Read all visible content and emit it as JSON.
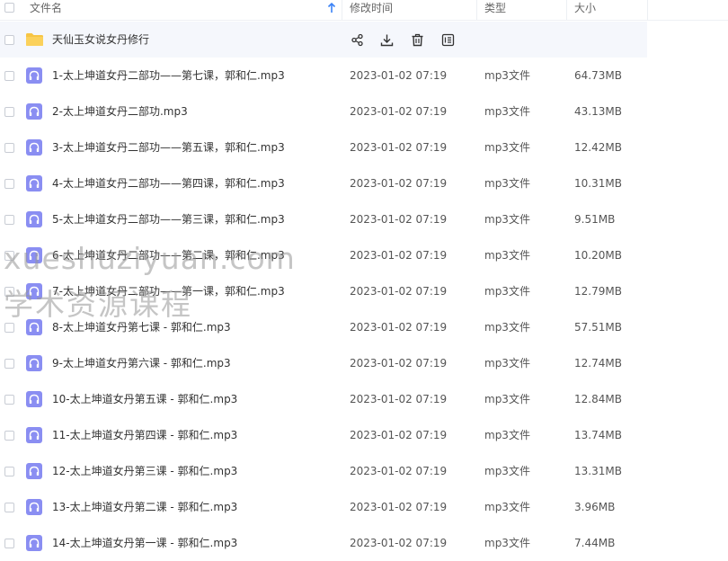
{
  "header": {
    "name_label": "文件名",
    "time_label": "修改时间",
    "type_label": "类型",
    "size_label": "大小"
  },
  "folder": {
    "name": "天仙玉女说女丹修行",
    "actions": [
      "share-icon",
      "download-icon",
      "delete-icon",
      "more-icon"
    ]
  },
  "files": [
    {
      "name": "1-太上坤道女丹二部功——第七课，郭和仁.mp3",
      "time": "2023-01-02 07:19",
      "type": "mp3文件",
      "size": "64.73MB"
    },
    {
      "name": "2-太上坤道女丹二部功.mp3",
      "time": "2023-01-02 07:19",
      "type": "mp3文件",
      "size": "43.13MB"
    },
    {
      "name": "3-太上坤道女丹二部功——第五课，郭和仁.mp3",
      "time": "2023-01-02 07:19",
      "type": "mp3文件",
      "size": "12.42MB"
    },
    {
      "name": "4-太上坤道女丹二部功——第四课，郭和仁.mp3",
      "time": "2023-01-02 07:19",
      "type": "mp3文件",
      "size": "10.31MB"
    },
    {
      "name": "5-太上坤道女丹二部功——第三课，郭和仁.mp3",
      "time": "2023-01-02 07:19",
      "type": "mp3文件",
      "size": "9.51MB"
    },
    {
      "name": "6-太上坤道女丹二部功——第二课，郭和仁.mp3",
      "time": "2023-01-02 07:19",
      "type": "mp3文件",
      "size": "10.20MB"
    },
    {
      "name": "7-太上坤道女丹二部功——第一课，郭和仁.mp3",
      "time": "2023-01-02 07:19",
      "type": "mp3文件",
      "size": "12.79MB"
    },
    {
      "name": "8-太上坤道女丹第七课 - 郭和仁.mp3",
      "time": "2023-01-02 07:19",
      "type": "mp3文件",
      "size": "57.51MB"
    },
    {
      "name": "9-太上坤道女丹第六课 - 郭和仁.mp3",
      "time": "2023-01-02 07:19",
      "type": "mp3文件",
      "size": "12.74MB"
    },
    {
      "name": "10-太上坤道女丹第五课 - 郭和仁.mp3",
      "time": "2023-01-02 07:19",
      "type": "mp3文件",
      "size": "12.84MB"
    },
    {
      "name": "11-太上坤道女丹第四课 - 郭和仁.mp3",
      "time": "2023-01-02 07:19",
      "type": "mp3文件",
      "size": "13.74MB"
    },
    {
      "name": "12-太上坤道女丹第三课 - 郭和仁.mp3",
      "time": "2023-01-02 07:19",
      "type": "mp3文件",
      "size": "13.31MB"
    },
    {
      "name": "13-太上坤道女丹第二课 - 郭和仁.mp3",
      "time": "2023-01-02 07:19",
      "type": "mp3文件",
      "size": "3.96MB"
    },
    {
      "name": "14-太上坤道女丹第一课 - 郭和仁.mp3",
      "time": "2023-01-02 07:19",
      "type": "mp3文件",
      "size": "7.44MB"
    }
  ],
  "watermark": {
    "line1": "xueshuziyuan.com",
    "line2": "学术资源课程"
  },
  "colors": {
    "folder": "#f7c544",
    "audio_icon": "#8a8ef2",
    "folder_row_bg": "#f5f7fc",
    "sort_arrow": "#3b82f6"
  }
}
